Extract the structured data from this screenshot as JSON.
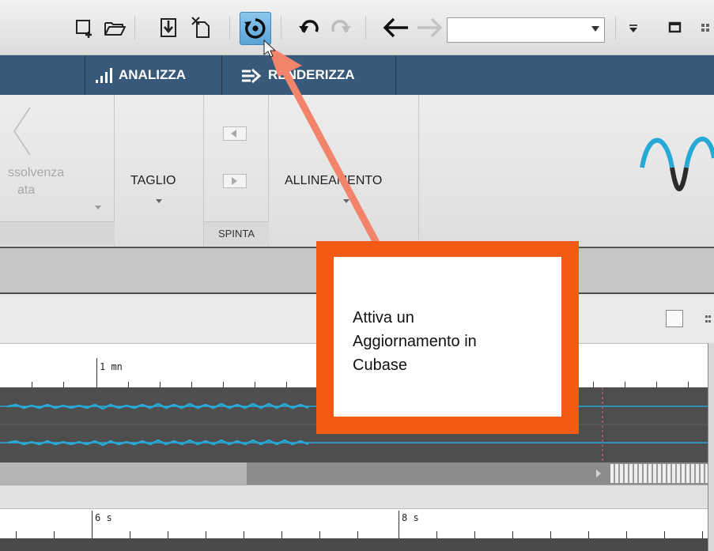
{
  "toolbar": {
    "icons": [
      "new-window-icon",
      "open-folder-icon",
      "save-download-icon",
      "close-file-icon",
      "refresh-icon",
      "undo-icon",
      "redo-icon",
      "back-arrow-icon",
      "forward-arrow-icon",
      "dropdown-arrow-icon",
      "maximize-icon"
    ],
    "history_value": "",
    "accent_color": "#5aa3d6"
  },
  "tabs": [
    {
      "label": "ANALIZZA",
      "icon": "bars-chart-icon"
    },
    {
      "label": "RENDERIZZA",
      "icon": "render-arrow-icon"
    }
  ],
  "ribbon": {
    "crossfade_label_line1": "ssolvenza",
    "crossfade_label_line2": "ata",
    "taglio_label": "TAGLIO",
    "spinta_label": "SPINTA",
    "allineamento_label": "ALLINEAMENTO"
  },
  "ruler1": {
    "label": "1 mn"
  },
  "ruler2": {
    "labels": [
      "6 s",
      "8 s"
    ]
  },
  "callout": {
    "lines": [
      "Attiva un",
      "Aggiornamento in",
      "Cubase"
    ],
    "border_color": "#f35a13",
    "arrow_color": "#f3846c"
  },
  "colors": {
    "tabbar": "#39597a",
    "waveform": "#27a9d8"
  }
}
